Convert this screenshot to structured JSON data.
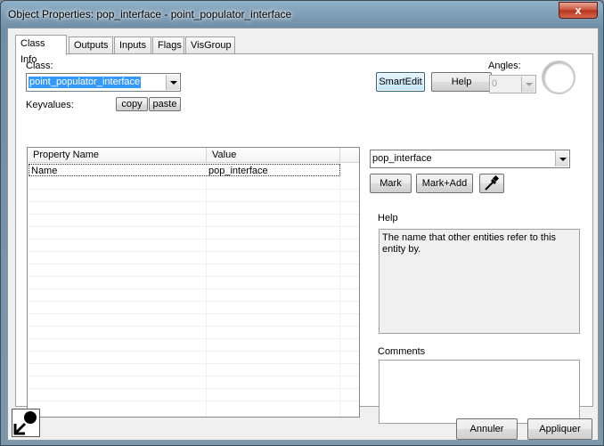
{
  "window": {
    "title": "Object Properties: pop_interface - point_populator_interface",
    "close_label": "x"
  },
  "tabs": [
    {
      "label": "Class Info",
      "active": true
    },
    {
      "label": "Outputs"
    },
    {
      "label": "Inputs"
    },
    {
      "label": "Flags"
    },
    {
      "label": "VisGroup"
    }
  ],
  "class_section": {
    "class_label": "Class:",
    "class_value": "point_populator_interface",
    "keyvalues_label": "Keyvalues:",
    "copy_label": "copy",
    "paste_label": "paste",
    "smartedit_label": "SmartEdit",
    "help_label": "Help",
    "angles_label": "Angles:",
    "angles_value": "0"
  },
  "property_list": {
    "columns": [
      "Property Name",
      "Value"
    ],
    "rows": [
      {
        "name": "Name",
        "value": "pop_interface"
      }
    ]
  },
  "value_editor": {
    "value_text": "pop_interface",
    "mark_label": "Mark",
    "mark_add_label": "Mark+Add",
    "eyedropper_icon": "eyedropper-icon"
  },
  "help_box": {
    "label": "Help",
    "text": "The name that other entities refer to this entity by."
  },
  "comments_box": {
    "label": "Comments",
    "text": ""
  },
  "footer": {
    "cancel_label": "Annuler",
    "apply_label": "Appliquer"
  }
}
